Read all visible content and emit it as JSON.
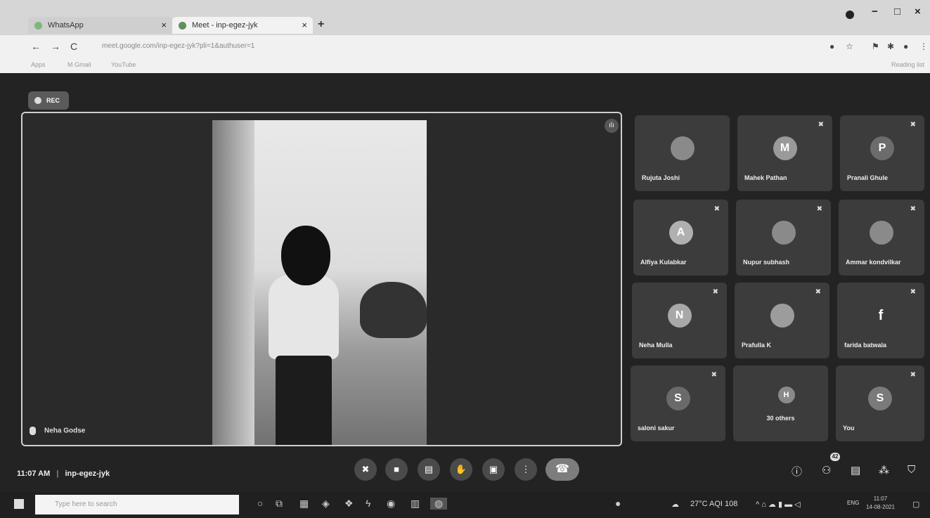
{
  "browser": {
    "tabs": [
      {
        "label": "WhatsApp",
        "close": "×"
      },
      {
        "label": "Meet - inp-egez-jyk",
        "close": "×"
      }
    ],
    "new_tab": "+",
    "window_controls": [
      "−",
      "□",
      "×"
    ],
    "nav": {
      "back": "←",
      "forward": "→",
      "reload": "C"
    },
    "address": "meet.google.com/inp-egez-jyk?pli=1&authuser=1",
    "bookmarks": [
      "Apps",
      "M Gmail",
      "YouTube"
    ],
    "reading_list": "Reading list"
  },
  "meet": {
    "rec_label": "REC",
    "main_speaker": "Neha Godse",
    "meeting_time": "11:07 AM",
    "meeting_code": "inp-egez-jyk",
    "participants": [
      {
        "name": "Rujuta Joshi",
        "initial": "",
        "color": "#8a8a8a",
        "muted": false
      },
      {
        "name": "Mahek Pathan",
        "initial": "M",
        "color": "#9a9a9a",
        "muted": true
      },
      {
        "name": "Pranali Ghule",
        "initial": "P",
        "color": "#6c6c6c",
        "muted": true
      },
      {
        "name": "Alfiya Kulabkar",
        "initial": "A",
        "color": "#b0b0b0",
        "muted": true
      },
      {
        "name": "Nupur subhash",
        "initial": "",
        "color": "#8a8a8a",
        "muted": true
      },
      {
        "name": "Ammar kondvilkar",
        "initial": "",
        "color": "#8a8a8a",
        "muted": true
      },
      {
        "name": "Neha Mulla",
        "initial": "N",
        "color": "#a8a8a8",
        "muted": true
      },
      {
        "name": "Prafulla K",
        "initial": "",
        "color": "#9c9c9c",
        "muted": true
      },
      {
        "name": "farida batwala",
        "initial": "f",
        "color": "#3c3c3c",
        "muted": false
      },
      {
        "name": "saloni sakur",
        "initial": "S",
        "color": "#6a6a6a",
        "muted": true
      },
      {
        "name": "",
        "initial": "H",
        "color": "#8a8a8a",
        "muted": false
      },
      {
        "name": "You",
        "initial": "S",
        "color": "#7a7a7a",
        "muted": true
      }
    ],
    "others_label": "30 others",
    "people_count": "42"
  },
  "taskbar": {
    "search_placeholder": "Type here to search",
    "weather": "27°C AQI 108",
    "language": "ENG",
    "clock_time": "11:07",
    "clock_date": "14-08-2021"
  }
}
